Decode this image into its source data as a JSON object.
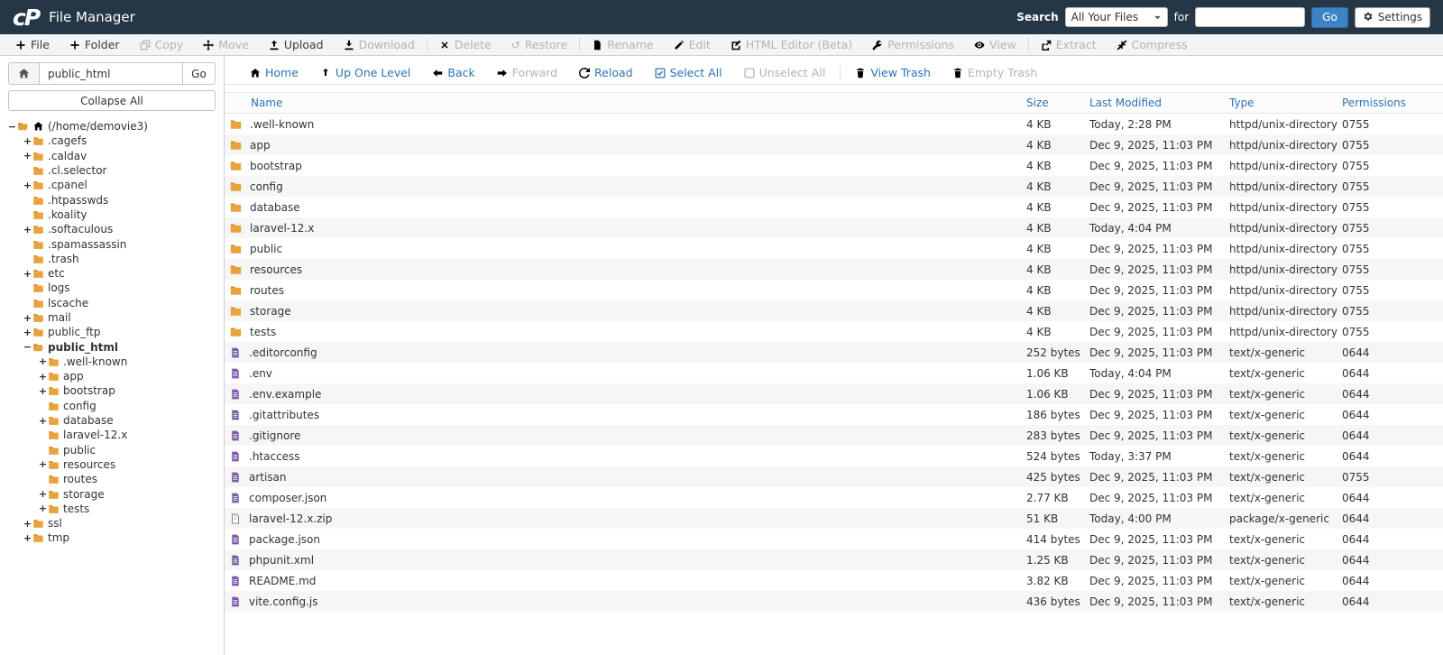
{
  "header": {
    "logo": "cP",
    "title": "File Manager",
    "search_label": "Search",
    "search_filter": "All Your Files",
    "for_label": "for",
    "go_label": "Go",
    "settings_label": "Settings"
  },
  "toolbar": {
    "items": [
      {
        "label": "File",
        "icon": "plus",
        "enabled": true
      },
      {
        "label": "Folder",
        "icon": "plus",
        "enabled": true
      },
      {
        "label": "Copy",
        "icon": "copy",
        "enabled": false
      },
      {
        "label": "Move",
        "icon": "move",
        "enabled": false
      },
      {
        "label": "Upload",
        "icon": "upload",
        "enabled": true
      },
      {
        "label": "Download",
        "icon": "download",
        "enabled": false
      },
      {
        "label": "Delete",
        "icon": "delete",
        "enabled": false,
        "divider_before": true
      },
      {
        "label": "Restore",
        "icon": "restore",
        "enabled": false
      },
      {
        "label": "Rename",
        "icon": "rename",
        "enabled": false,
        "divider_before": true
      },
      {
        "label": "Edit",
        "icon": "edit",
        "enabled": false
      },
      {
        "label": "HTML Editor (Beta)",
        "icon": "html-editor",
        "enabled": false
      },
      {
        "label": "Permissions",
        "icon": "key",
        "enabled": false
      },
      {
        "label": "View",
        "icon": "eye",
        "enabled": false
      },
      {
        "label": "Extract",
        "icon": "extract",
        "enabled": false,
        "divider_before": true
      },
      {
        "label": "Compress",
        "icon": "compress",
        "enabled": false
      }
    ]
  },
  "sidebar": {
    "path_value": "public_html",
    "go_label": "Go",
    "collapse_all_label": "Collapse All",
    "tree": [
      {
        "label": "(/home/demovie3)",
        "depth": 0,
        "toggle": "-",
        "icon": "folder-open",
        "home": true
      },
      {
        "label": ".cagefs",
        "depth": 1,
        "toggle": "+"
      },
      {
        "label": ".caldav",
        "depth": 1,
        "toggle": "+"
      },
      {
        "label": ".cl.selector",
        "depth": 1
      },
      {
        "label": ".cpanel",
        "depth": 1,
        "toggle": "+"
      },
      {
        "label": ".htpasswds",
        "depth": 1
      },
      {
        "label": ".koality",
        "depth": 1
      },
      {
        "label": ".softaculous",
        "depth": 1,
        "toggle": "+"
      },
      {
        "label": ".spamassassin",
        "depth": 1
      },
      {
        "label": ".trash",
        "depth": 1
      },
      {
        "label": "etc",
        "depth": 1,
        "toggle": "+"
      },
      {
        "label": "logs",
        "depth": 1
      },
      {
        "label": "lscache",
        "depth": 1
      },
      {
        "label": "mail",
        "depth": 1,
        "toggle": "+"
      },
      {
        "label": "public_ftp",
        "depth": 1,
        "toggle": "+"
      },
      {
        "label": "public_html",
        "depth": 1,
        "toggle": "-",
        "icon": "folder-open",
        "bold": true
      },
      {
        "label": ".well-known",
        "depth": 2,
        "toggle": "+"
      },
      {
        "label": "app",
        "depth": 2,
        "toggle": "+"
      },
      {
        "label": "bootstrap",
        "depth": 2,
        "toggle": "+"
      },
      {
        "label": "config",
        "depth": 2
      },
      {
        "label": "database",
        "depth": 2,
        "toggle": "+"
      },
      {
        "label": "laravel-12.x",
        "depth": 2
      },
      {
        "label": "public",
        "depth": 2
      },
      {
        "label": "resources",
        "depth": 2,
        "toggle": "+"
      },
      {
        "label": "routes",
        "depth": 2
      },
      {
        "label": "storage",
        "depth": 2,
        "toggle": "+"
      },
      {
        "label": "tests",
        "depth": 2,
        "toggle": "+"
      },
      {
        "label": "ssl",
        "depth": 1,
        "toggle": "+"
      },
      {
        "label": "tmp",
        "depth": 1,
        "toggle": "+"
      }
    ]
  },
  "filewindow": {
    "nav": [
      {
        "label": "Home",
        "icon": "home",
        "enabled": true
      },
      {
        "label": "Up One Level",
        "icon": "up-level",
        "enabled": true
      },
      {
        "label": "Back",
        "icon": "arrow-left",
        "enabled": true
      },
      {
        "label": "Forward",
        "icon": "arrow-right",
        "enabled": false
      },
      {
        "label": "Reload",
        "icon": "reload",
        "enabled": true
      },
      {
        "label": "Select All",
        "icon": "checkbox-checked",
        "enabled": true
      },
      {
        "label": "Unselect All",
        "icon": "checkbox-empty",
        "enabled": false
      },
      {
        "label": "View Trash",
        "icon": "trash",
        "enabled": true,
        "divider_before": true
      },
      {
        "label": "Empty Trash",
        "icon": "trash",
        "enabled": false
      }
    ],
    "columns": [
      "Name",
      "Size",
      "Last Modified",
      "Type",
      "Permissions"
    ],
    "rows": [
      {
        "name": ".well-known",
        "icon": "folder",
        "size": "4 KB",
        "modified": "Today, 2:28 PM",
        "type": "httpd/unix-directory",
        "perms": "0755"
      },
      {
        "name": "app",
        "icon": "folder",
        "size": "4 KB",
        "modified": "Dec 9, 2025, 11:03 PM",
        "type": "httpd/unix-directory",
        "perms": "0755"
      },
      {
        "name": "bootstrap",
        "icon": "folder",
        "size": "4 KB",
        "modified": "Dec 9, 2025, 11:03 PM",
        "type": "httpd/unix-directory",
        "perms": "0755"
      },
      {
        "name": "config",
        "icon": "folder",
        "size": "4 KB",
        "modified": "Dec 9, 2025, 11:03 PM",
        "type": "httpd/unix-directory",
        "perms": "0755"
      },
      {
        "name": "database",
        "icon": "folder",
        "size": "4 KB",
        "modified": "Dec 9, 2025, 11:03 PM",
        "type": "httpd/unix-directory",
        "perms": "0755"
      },
      {
        "name": "laravel-12.x",
        "icon": "folder",
        "size": "4 KB",
        "modified": "Today, 4:04 PM",
        "type": "httpd/unix-directory",
        "perms": "0755"
      },
      {
        "name": "public",
        "icon": "folder",
        "size": "4 KB",
        "modified": "Dec 9, 2025, 11:03 PM",
        "type": "httpd/unix-directory",
        "perms": "0755"
      },
      {
        "name": "resources",
        "icon": "folder",
        "size": "4 KB",
        "modified": "Dec 9, 2025, 11:03 PM",
        "type": "httpd/unix-directory",
        "perms": "0755"
      },
      {
        "name": "routes",
        "icon": "folder",
        "size": "4 KB",
        "modified": "Dec 9, 2025, 11:03 PM",
        "type": "httpd/unix-directory",
        "perms": "0755"
      },
      {
        "name": "storage",
        "icon": "folder",
        "size": "4 KB",
        "modified": "Dec 9, 2025, 11:03 PM",
        "type": "httpd/unix-directory",
        "perms": "0755"
      },
      {
        "name": "tests",
        "icon": "folder",
        "size": "4 KB",
        "modified": "Dec 9, 2025, 11:03 PM",
        "type": "httpd/unix-directory",
        "perms": "0755"
      },
      {
        "name": ".editorconfig",
        "icon": "file",
        "size": "252 bytes",
        "modified": "Dec 9, 2025, 11:03 PM",
        "type": "text/x-generic",
        "perms": "0644"
      },
      {
        "name": ".env",
        "icon": "file",
        "size": "1.06 KB",
        "modified": "Today, 4:04 PM",
        "type": "text/x-generic",
        "perms": "0644"
      },
      {
        "name": ".env.example",
        "icon": "file",
        "size": "1.06 KB",
        "modified": "Dec 9, 2025, 11:03 PM",
        "type": "text/x-generic",
        "perms": "0644"
      },
      {
        "name": ".gitattributes",
        "icon": "file",
        "size": "186 bytes",
        "modified": "Dec 9, 2025, 11:03 PM",
        "type": "text/x-generic",
        "perms": "0644"
      },
      {
        "name": ".gitignore",
        "icon": "file",
        "size": "283 bytes",
        "modified": "Dec 9, 2025, 11:03 PM",
        "type": "text/x-generic",
        "perms": "0644"
      },
      {
        "name": ".htaccess",
        "icon": "file",
        "size": "524 bytes",
        "modified": "Today, 3:37 PM",
        "type": "text/x-generic",
        "perms": "0644"
      },
      {
        "name": "artisan",
        "icon": "file",
        "size": "425 bytes",
        "modified": "Dec 9, 2025, 11:03 PM",
        "type": "text/x-generic",
        "perms": "0755"
      },
      {
        "name": "composer.json",
        "icon": "file",
        "size": "2.77 KB",
        "modified": "Dec 9, 2025, 11:03 PM",
        "type": "text/x-generic",
        "perms": "0644"
      },
      {
        "name": "laravel-12.x.zip",
        "icon": "zip",
        "size": "51 KB",
        "modified": "Today, 4:00 PM",
        "type": "package/x-generic",
        "perms": "0644"
      },
      {
        "name": "package.json",
        "icon": "file",
        "size": "414 bytes",
        "modified": "Dec 9, 2025, 11:03 PM",
        "type": "text/x-generic",
        "perms": "0644"
      },
      {
        "name": "phpunit.xml",
        "icon": "file",
        "size": "1.25 KB",
        "modified": "Dec 9, 2025, 11:03 PM",
        "type": "text/x-generic",
        "perms": "0644"
      },
      {
        "name": "README.md",
        "icon": "file",
        "size": "3.82 KB",
        "modified": "Dec 9, 2025, 11:03 PM",
        "type": "text/x-generic",
        "perms": "0644"
      },
      {
        "name": "vite.config.js",
        "icon": "file",
        "size": "436 bytes",
        "modified": "Dec 9, 2025, 11:03 PM",
        "type": "text/x-generic",
        "perms": "0644"
      }
    ]
  },
  "colors": {
    "header_bg": "#253746",
    "accent_blue": "#2a74b5",
    "button_blue": "#3c84c6",
    "folder_orange": "#e9a33c",
    "file_purple": "#7b5ea7",
    "disabled_gray": "#b3b3b3"
  }
}
